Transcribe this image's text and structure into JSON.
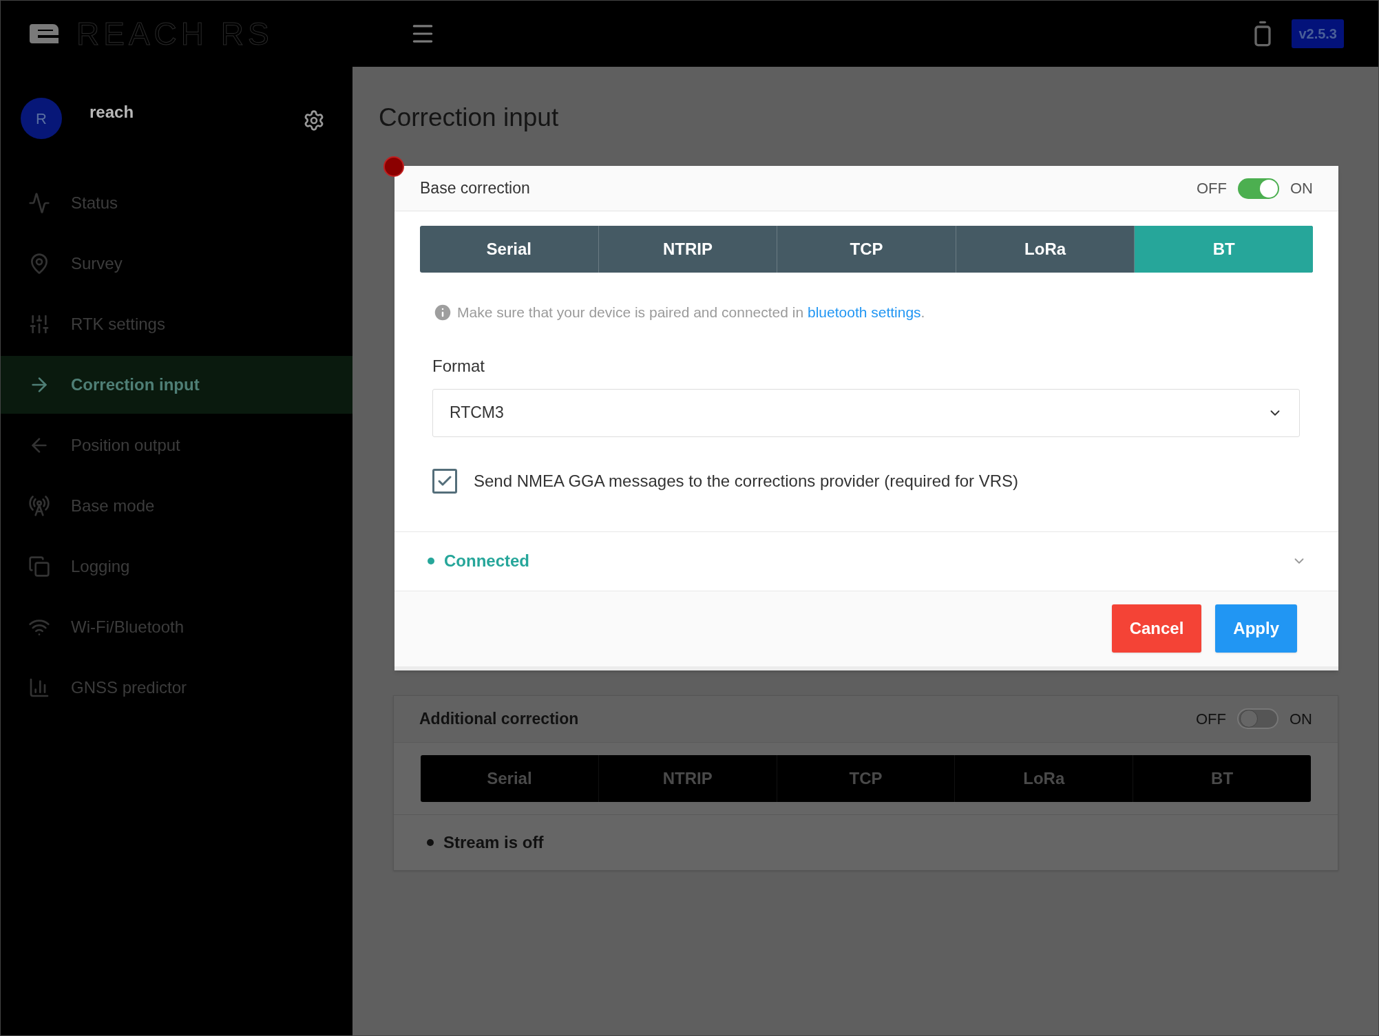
{
  "header": {
    "logo_text": "REACH RS",
    "version": "v2.5.3"
  },
  "user": {
    "avatar_letter": "R",
    "name": "reach"
  },
  "sidebar": {
    "items": [
      {
        "label": "Status",
        "selected": false
      },
      {
        "label": "Survey",
        "selected": false
      },
      {
        "label": "RTK settings",
        "selected": false
      },
      {
        "label": "Correction input",
        "selected": true
      },
      {
        "label": "Position output",
        "selected": false
      },
      {
        "label": "Base mode",
        "selected": false
      },
      {
        "label": "Logging",
        "selected": false
      },
      {
        "label": "Wi-Fi/Bluetooth",
        "selected": false
      },
      {
        "label": "GNSS predictor",
        "selected": false
      }
    ]
  },
  "page_title": "Correction input",
  "base_correction": {
    "title": "Base correction",
    "switch": {
      "off_label": "OFF",
      "on_label": "ON",
      "on": true
    },
    "tabs": [
      {
        "label": "Serial",
        "selected": false
      },
      {
        "label": "NTRIP",
        "selected": false
      },
      {
        "label": "TCP",
        "selected": false
      },
      {
        "label": "LoRa",
        "selected": false
      },
      {
        "label": "BT",
        "selected": true
      }
    ],
    "info": {
      "text": "Make sure that your device is paired and connected in",
      "link": "bluetooth settings",
      "after": "."
    },
    "format": {
      "label": "Format",
      "value": "RTCM3"
    },
    "checkbox": {
      "label": "Send NMEA GGA messages to the corrections provider (required for VRS)",
      "checked": true
    },
    "status": {
      "text": "Connected",
      "kind": "connected"
    },
    "buttons": [
      {
        "label": "Cancel",
        "kind": "cancel"
      },
      {
        "label": "Apply",
        "kind": "apply"
      }
    ]
  },
  "additional_correction": {
    "title": "Additional correction",
    "switch": {
      "off_label": "OFF",
      "on_label": "ON",
      "on": false
    },
    "tabs": [
      {
        "label": "Serial",
        "selected": false
      },
      {
        "label": "NTRIP",
        "selected": false
      },
      {
        "label": "TCP",
        "selected": false
      },
      {
        "label": "LoRa",
        "selected": false
      },
      {
        "label": "BT",
        "selected": false
      }
    ],
    "status": {
      "text": "Stream is off",
      "kind": "off"
    }
  }
}
